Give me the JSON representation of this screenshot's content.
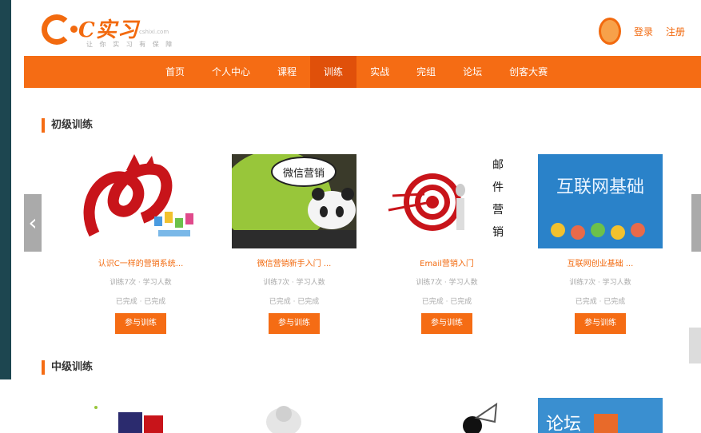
{
  "header": {
    "logo_text": "C实习",
    "logo_sub": "让 你 实 习 有 保 障",
    "logo_sub2": "cshixi.com",
    "login": "登录",
    "register": "注册"
  },
  "nav": {
    "items": [
      "首页",
      "个人中心",
      "课程",
      "训练",
      "实战",
      "完组",
      "论坛",
      "创客大赛"
    ],
    "active_index": 3
  },
  "sections": {
    "beginner": "初级训练",
    "intermediate": "中级训练"
  },
  "cards": [
    {
      "title": "认识C一样的营销系统...",
      "meta1": "训练7次 · 学习人数",
      "meta2": "已完成 · 已完成",
      "button": "参与训练",
      "image": "red-3d-art"
    },
    {
      "title": "微信营销新手入门 ...",
      "meta1": "训练7次 · 学习人数",
      "meta2": "已完成 · 已完成",
      "button": "参与训练",
      "image": "wechat-panda"
    },
    {
      "title": "Email营销入门",
      "meta1": "训练7次 · 学习人数",
      "meta2": "已完成 · 已完成",
      "button": "参与训练",
      "image": "email-target"
    },
    {
      "title": "互联网创业基础 ...",
      "meta1": "训练7次 · 学习人数",
      "meta2": "已完成 · 已完成",
      "button": "参与训练",
      "image": "internet-basics"
    }
  ],
  "card4_banner": "互联网基础",
  "card2_bubble": "微信营销",
  "card3_vertical": [
    "邮",
    "件",
    "营",
    "销"
  ],
  "bottom_thumb4_text": "论坛",
  "colors": {
    "accent": "#f56c14",
    "accent_dark": "#e0500a",
    "left_panel": "#1d4650"
  }
}
